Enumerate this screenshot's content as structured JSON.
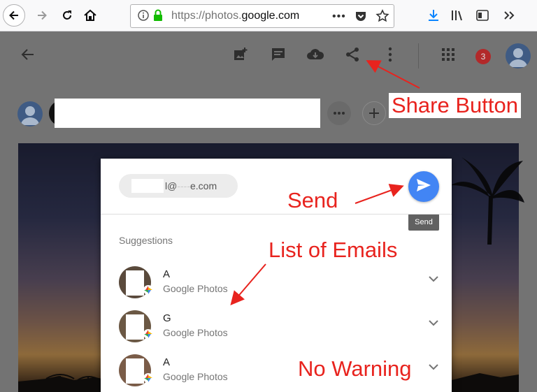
{
  "browser": {
    "url_prefix": "https://photos.",
    "url_domain": "google.com",
    "icons": [
      "back-arrow-icon",
      "forward-arrow-icon",
      "reload-icon",
      "home-icon",
      "info-icon",
      "lock-icon",
      "more-dots-icon",
      "pocket-icon",
      "bookmark-star-icon",
      "download-icon",
      "library-icon",
      "sidebar-icon",
      "overflow-chevrons-icon"
    ]
  },
  "app": {
    "notification_count": "3",
    "toolbar_icons": [
      "add-to-album-icon",
      "comment-icon",
      "download-cloud-icon",
      "share-icon",
      "more-vert-icon",
      "apps-grid-icon"
    ]
  },
  "share_dialog": {
    "email_value": "l@",
    "email_value_tail": "e.com",
    "send_tooltip": "Send",
    "suggestions_label": "Suggestions",
    "contacts": [
      {
        "name": "A",
        "source": "Google Photos"
      },
      {
        "name": "G",
        "source": "Google Photos"
      },
      {
        "name": "A",
        "source": "Google Photos"
      }
    ]
  },
  "annotations": {
    "share_button": "Share Button",
    "send": "Send",
    "list_of_emails": "List of Emails",
    "no_warning": "No Warning"
  },
  "colors": {
    "accent_blue": "#4285f4",
    "annotation_red": "#e8231e",
    "badge_red": "#b2292a"
  }
}
